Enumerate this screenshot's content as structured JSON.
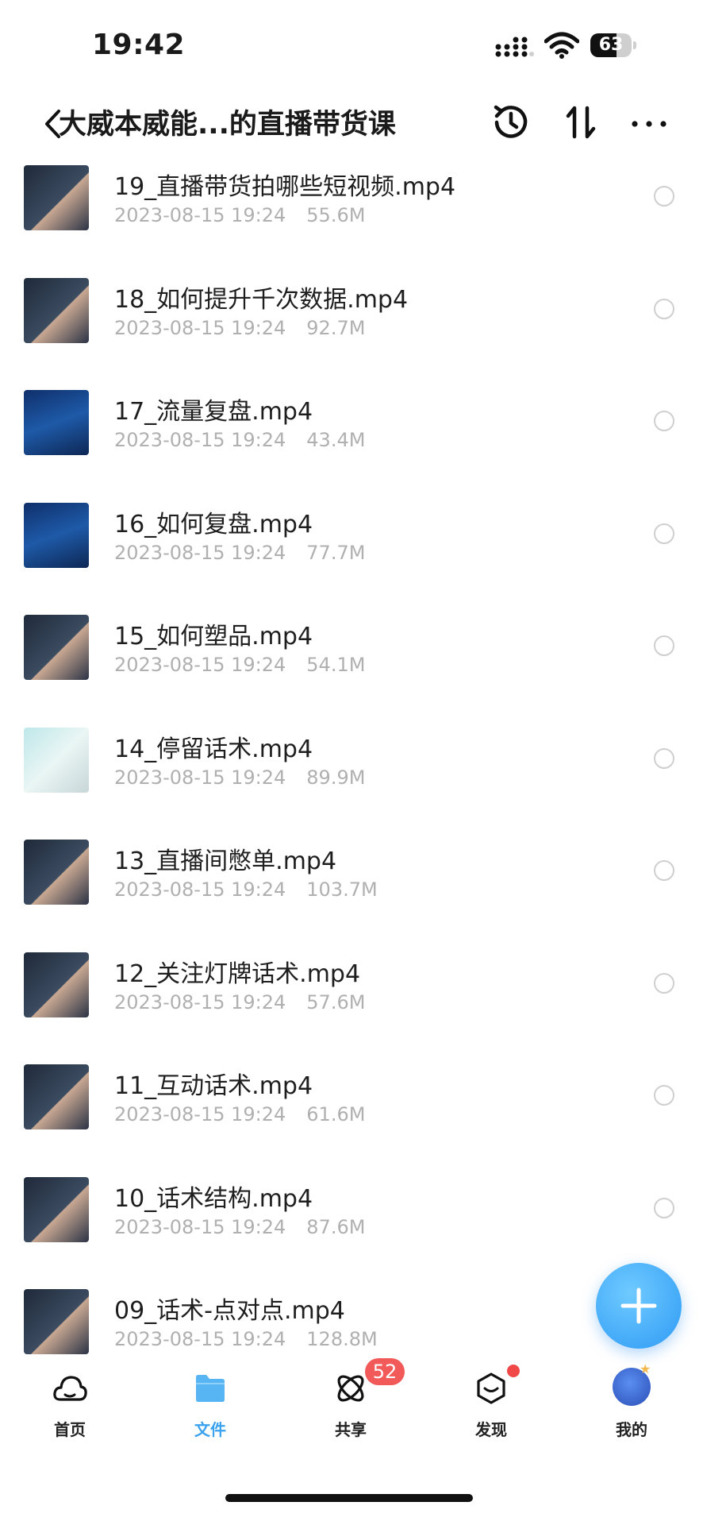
{
  "status_bar": {
    "time": "19:42",
    "battery": "63",
    "battery_level": 0.63
  },
  "header": {
    "title": "大威本威能...的直播带货课"
  },
  "files": [
    {
      "name": "19_直播带货拍哪些短视频.mp4",
      "date": "2023-08-15 19:24",
      "size": "55.6M",
      "thumb": "dark"
    },
    {
      "name": "18_如何提升千次数据.mp4",
      "date": "2023-08-15 19:24",
      "size": "92.7M",
      "thumb": "dark"
    },
    {
      "name": "17_流量复盘.mp4",
      "date": "2023-08-15 19:24",
      "size": "43.4M",
      "thumb": "blue"
    },
    {
      "name": "16_如何复盘.mp4",
      "date": "2023-08-15 19:24",
      "size": "77.7M",
      "thumb": "blue"
    },
    {
      "name": "15_如何塑品.mp4",
      "date": "2023-08-15 19:24",
      "size": "54.1M",
      "thumb": "dark"
    },
    {
      "name": "14_停留话术.mp4",
      "date": "2023-08-15 19:24",
      "size": "89.9M",
      "thumb": "light"
    },
    {
      "name": "13_直播间憋单.mp4",
      "date": "2023-08-15 19:24",
      "size": "103.7M",
      "thumb": "dark"
    },
    {
      "name": "12_关注灯牌话术.mp4",
      "date": "2023-08-15 19:24",
      "size": "57.6M",
      "thumb": "dark"
    },
    {
      "name": "11_互动话术.mp4",
      "date": "2023-08-15 19:24",
      "size": "61.6M",
      "thumb": "dark"
    },
    {
      "name": "10_话术结构.mp4",
      "date": "2023-08-15 19:24",
      "size": "87.6M",
      "thumb": "dark"
    },
    {
      "name": "09_话术-点对点.mp4",
      "date": "2023-08-15 19:24",
      "size": "128.8M",
      "thumb": "dark"
    }
  ],
  "tabs": [
    {
      "label": "首页",
      "icon": "cloud-icon",
      "active": false
    },
    {
      "label": "文件",
      "icon": "folder-icon",
      "active": true
    },
    {
      "label": "共享",
      "icon": "share-icon",
      "active": false,
      "badge": "52"
    },
    {
      "label": "发现",
      "icon": "discover-icon",
      "active": false,
      "dot": true
    },
    {
      "label": "我的",
      "icon": "avatar",
      "active": false
    }
  ],
  "colors": {
    "accent": "#3aa2ee",
    "badge": "#f25a5a",
    "meta_text": "#b0b0b0"
  }
}
